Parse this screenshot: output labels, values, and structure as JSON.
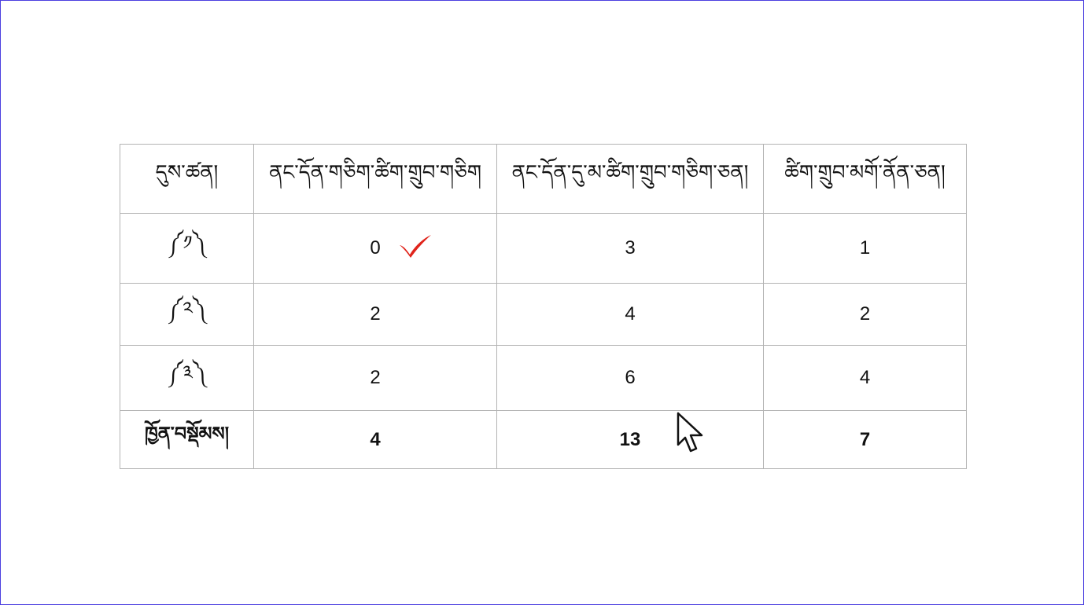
{
  "table": {
    "headers": [
      "དུས་ཚན།",
      "ནང་དོན་གཅིག་ཚིག་གྲུབ་གཅིག",
      "ནང་དོན་དུ་མ་ཚིག་གྲུབ་གཅིག་ཅན།",
      "ཚིག་གྲུབ་མགོ་ནོན་ཅན།"
    ],
    "rows": [
      {
        "label": "༼༡༽",
        "values": [
          "0",
          "3",
          "1"
        ]
      },
      {
        "label": "༼༢༽",
        "values": [
          "2",
          "4",
          "2"
        ]
      },
      {
        "label": "༼༣༽",
        "values": [
          "2",
          "6",
          "4"
        ]
      }
    ],
    "total": {
      "label": "ཁྱོན་བསྡོམས།",
      "values": [
        "4",
        "13",
        "7"
      ]
    }
  },
  "icons": {
    "check": "check-mark-icon",
    "cursor": "mouse-pointer-icon"
  },
  "colors": {
    "frame_border": "#4b3fe0",
    "check_mark": "#e0241b",
    "grid": "#b3b3b3"
  }
}
